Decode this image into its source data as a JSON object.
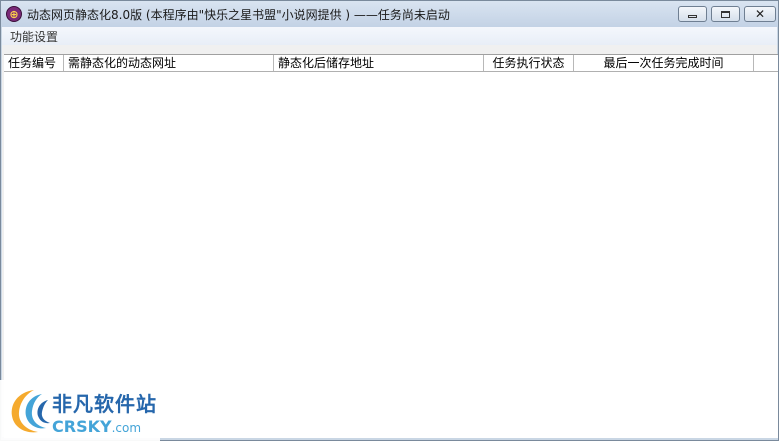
{
  "window": {
    "title": "动态网页静态化8.0版 (本程序由\"快乐之星书盟\"小说网提供 ) ——任务尚未启动",
    "app_icon": "globe-icon"
  },
  "menu": {
    "items": [
      {
        "label": "功能设置"
      }
    ]
  },
  "table": {
    "columns": [
      {
        "label": "任务编号"
      },
      {
        "label": "需静态化的动态网址"
      },
      {
        "label": "静态化后储存地址"
      },
      {
        "label": "任务执行状态"
      },
      {
        "label": "最后一次任务完成时间"
      }
    ],
    "rows": []
  },
  "watermark": {
    "name_cn": "非凡软件站",
    "name_en": "CRSKY",
    "domain_suffix": ".com"
  },
  "colors": {
    "titlebar": "#c9d6e4",
    "menubar": "#eef2f9",
    "list_background": "#ffffff",
    "watermark_blue": "#1b5fa8"
  }
}
